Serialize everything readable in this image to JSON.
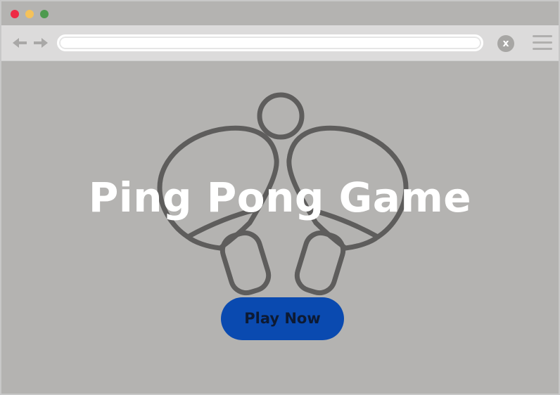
{
  "browser": {
    "window_controls": [
      {
        "name": "close",
        "color": "#ee2a45"
      },
      {
        "name": "minimize",
        "color": "#f5c25a"
      },
      {
        "name": "zoom",
        "color": "#4e9a4f"
      }
    ],
    "nav": {
      "back_icon": "arrow-left-icon",
      "forward_icon": "arrow-right-icon"
    },
    "address_bar": {
      "value": "",
      "placeholder": ""
    },
    "close_button": {
      "label": "x"
    },
    "menu_icon": "hamburger-menu-icon"
  },
  "page": {
    "background_color": "#b4b3b1",
    "title": "Ping Pong Game",
    "illustration": "ping-pong-paddles-icon",
    "play_button": {
      "label": "Play Now",
      "color": "#0a4ab0"
    }
  }
}
